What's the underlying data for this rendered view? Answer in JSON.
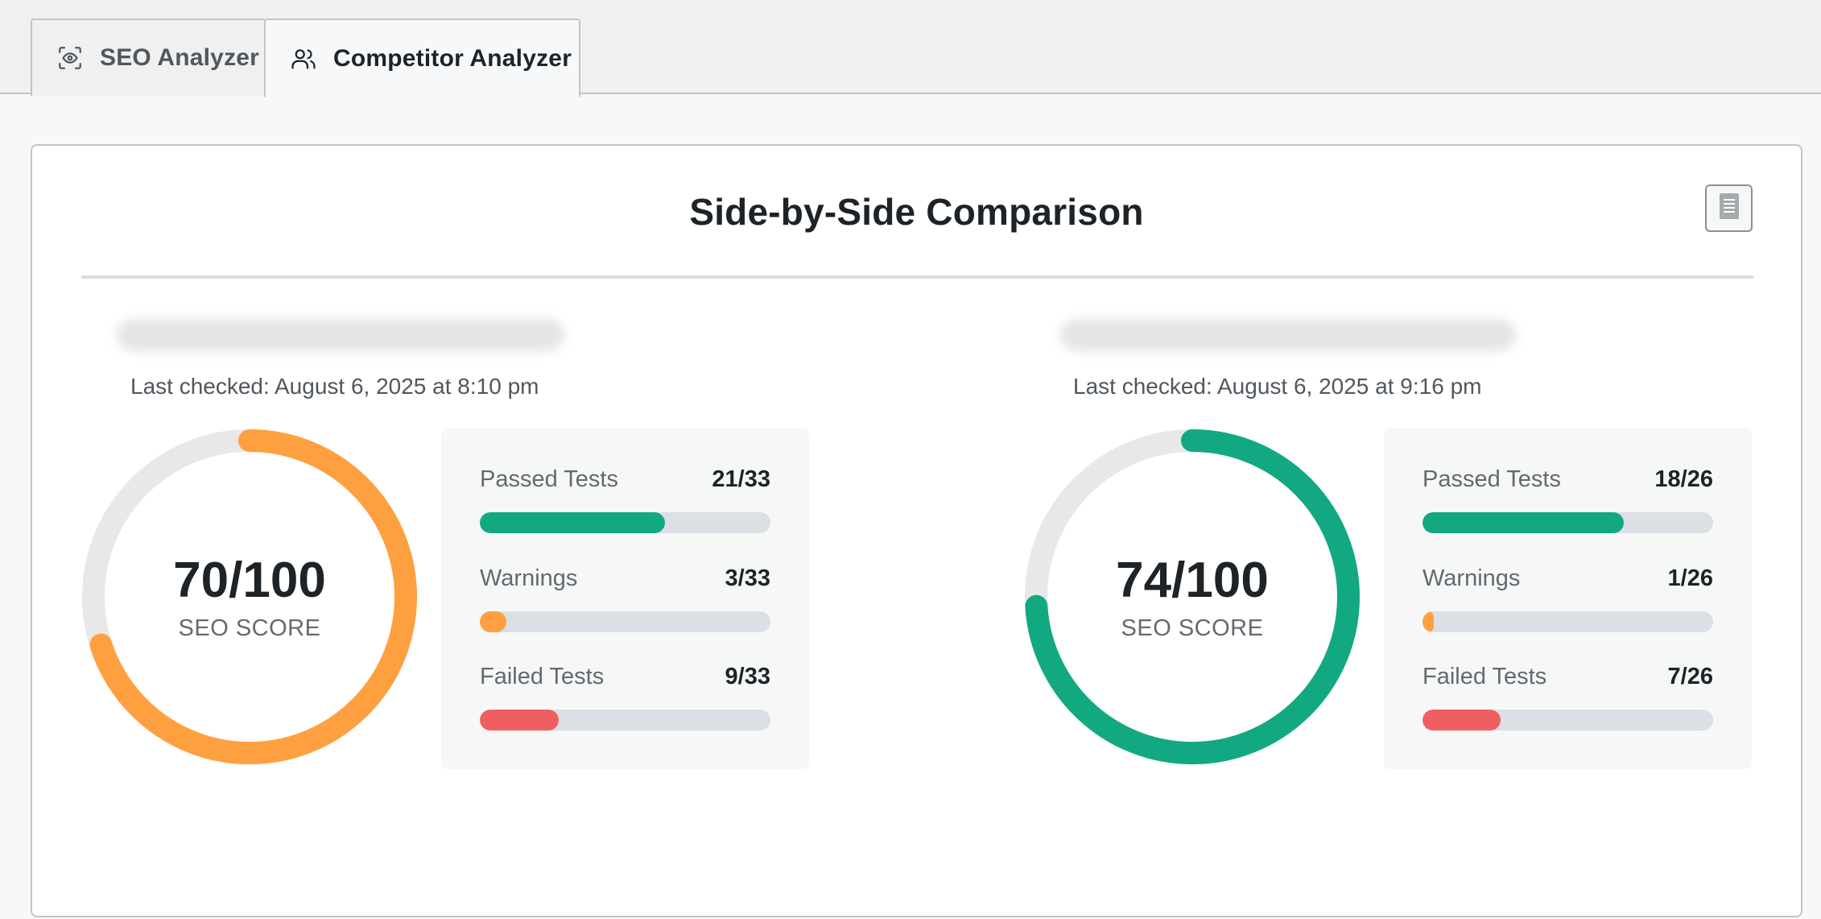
{
  "tabs": [
    {
      "label": "SEO Analyzer",
      "icon": "eye-scan-icon",
      "active": false
    },
    {
      "label": "Competitor Analyzer",
      "icon": "users-icon",
      "active": true
    }
  ],
  "card": {
    "title": "Side-by-Side Comparison",
    "export_icon": "document-icon"
  },
  "colors": {
    "orange": "#ffa040",
    "green": "#12a982",
    "red": "#ef5f61",
    "track": "#dcdfe3",
    "gauge_track": "#e8e8e8"
  },
  "sites": [
    {
      "last_checked": "Last checked: August 6, 2025 at 8:10 pm",
      "score": 70,
      "score_text": "70/100",
      "score_label": "SEO SCORE",
      "score_color": "#ffa040",
      "stats": [
        {
          "label": "Passed Tests",
          "value": "21/33",
          "count": 21,
          "total": 33,
          "color": "#12a982"
        },
        {
          "label": "Warnings",
          "value": "3/33",
          "count": 3,
          "total": 33,
          "color": "#ffa040"
        },
        {
          "label": "Failed Tests",
          "value": "9/33",
          "count": 9,
          "total": 33,
          "color": "#ef5f61"
        }
      ]
    },
    {
      "last_checked": "Last checked: August 6, 2025 at 9:16 pm",
      "score": 74,
      "score_text": "74/100",
      "score_label": "SEO SCORE",
      "score_color": "#12a982",
      "stats": [
        {
          "label": "Passed Tests",
          "value": "18/26",
          "count": 18,
          "total": 26,
          "color": "#12a982"
        },
        {
          "label": "Warnings",
          "value": "1/26",
          "count": 1,
          "total": 26,
          "color": "#ffa040"
        },
        {
          "label": "Failed Tests",
          "value": "7/26",
          "count": 7,
          "total": 26,
          "color": "#ef5f61"
        }
      ]
    }
  ]
}
